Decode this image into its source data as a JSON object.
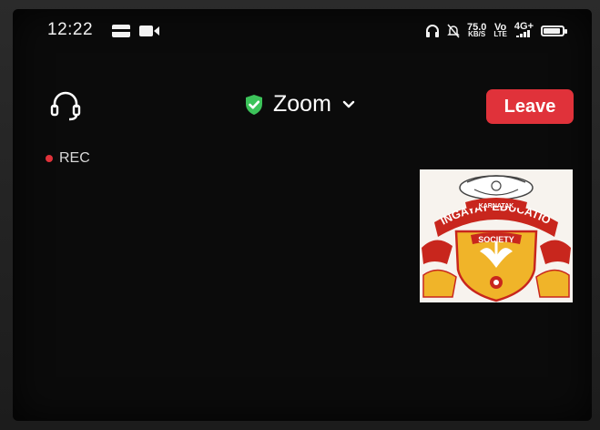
{
  "status_bar": {
    "time": "12:22",
    "net_speed_value": "75.0",
    "net_speed_unit": "KB/S",
    "signal_1": "Vo",
    "signal_1_sub": "LTE",
    "signal_2": "4G+"
  },
  "header": {
    "meeting_title": "Zoom",
    "leave_label": "Leave"
  },
  "recording": {
    "label": "REC"
  },
  "participant_tile": {
    "logo_line1": "KARNATAK",
    "logo_line2": "LINGAYAT EDUCATION",
    "logo_line3": "SOCIETY"
  },
  "colors": {
    "leave_button": "#e0323a",
    "rec_dot": "#e0323a",
    "shield": "#3cc35a",
    "logo_banner": "#c8261d",
    "logo_shield": "#f0b429"
  },
  "icons": {
    "headset": "headset-icon",
    "shield": "shield-check-icon",
    "dropdown": "chevron-down-icon"
  }
}
